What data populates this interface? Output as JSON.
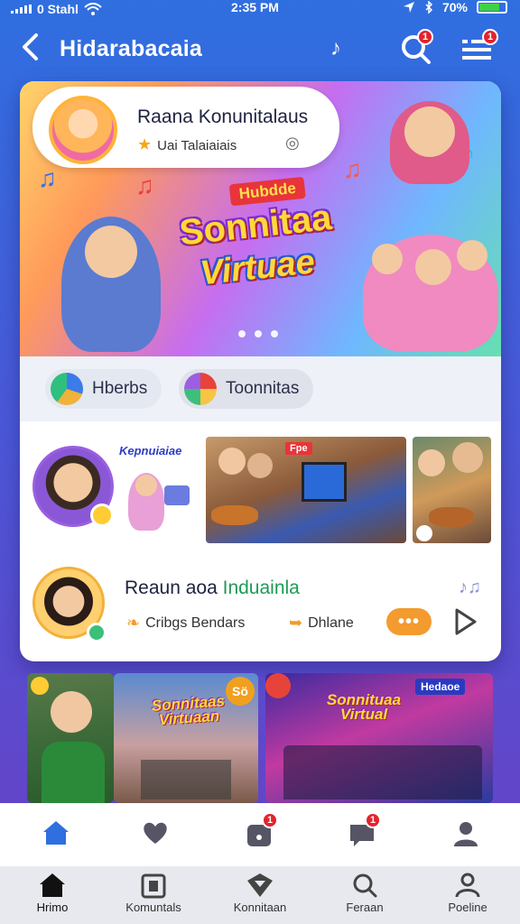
{
  "status_bar": {
    "carrier": "0 Stahl",
    "time": "2:35 PM",
    "battery": "70%"
  },
  "header": {
    "title": "Hidarabacaia",
    "search_badge": "1",
    "menu_badge": "1"
  },
  "hero": {
    "name": "Raana Konunitalaus",
    "subtitle": "Uai Talaiaiais",
    "sticker_line1": "Hubdde",
    "sticker_line2": "Sonnitaa",
    "sticker_line3": "Virtuae"
  },
  "chips": [
    {
      "label": "Hberbs"
    },
    {
      "label": "Toonnitas"
    }
  ],
  "media": {
    "bubble_text": "Kepnuiaiae",
    "tile2_label": "Fpe"
  },
  "post": {
    "name_part1": "Reaun aoa",
    "name_part2": "Induainla",
    "meta1": "Cribgs Bendars",
    "meta2": "Dhlane",
    "more_label": "•••"
  },
  "strip": {
    "tile1_badge": "Sö",
    "tile1_title": "Sonnitaas Virtuaan",
    "tile2_title": "Sonnituaa Virtual",
    "tile2_corner": "Hedaoe"
  },
  "tab_top": {
    "badge_feed": "1",
    "badge_chat": "1"
  },
  "tab_bottom": [
    {
      "label": "Hrimo"
    },
    {
      "label": "Komuntals"
    },
    {
      "label": "Konnitaan"
    },
    {
      "label": "Feraan"
    },
    {
      "label": "Poeline"
    }
  ],
  "colors": {
    "accent_blue": "#2f6fe0",
    "accent_orange": "#f39b2e",
    "badge_red": "#e3232c",
    "highlight_green": "#1e9a56"
  }
}
